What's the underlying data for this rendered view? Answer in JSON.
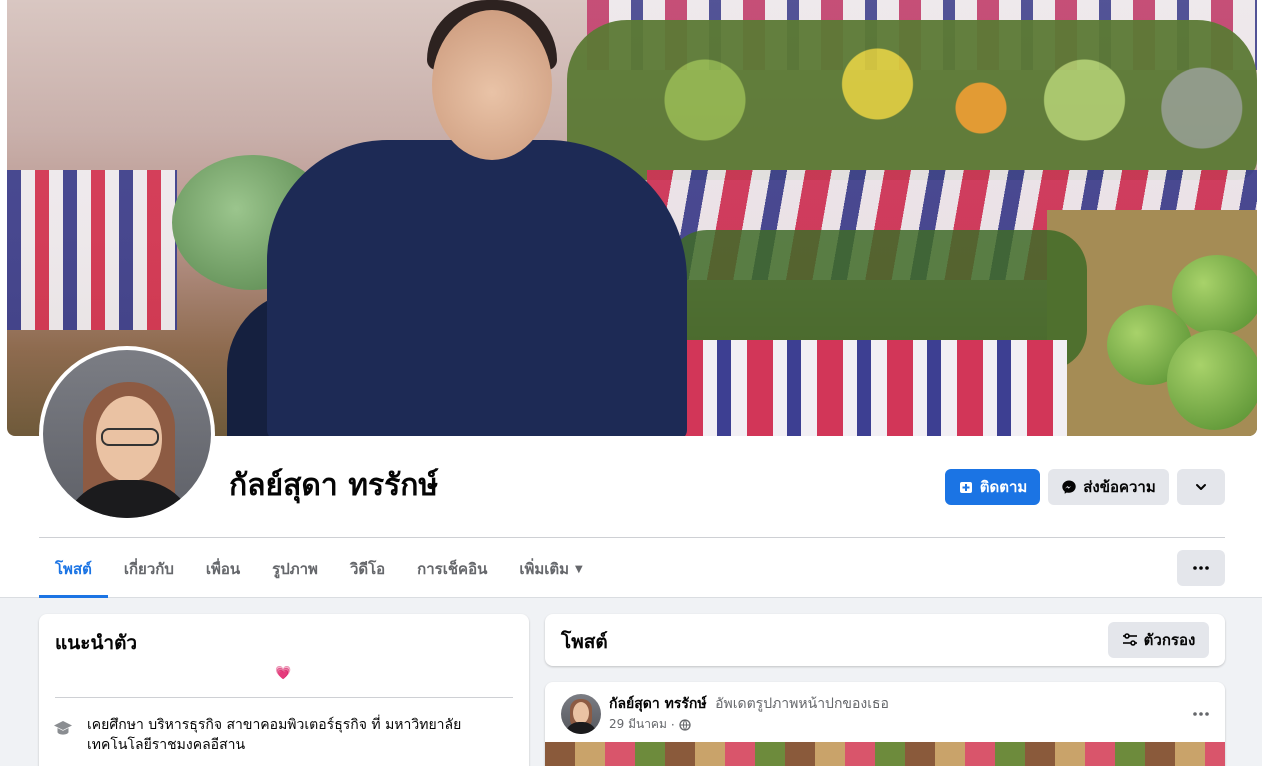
{
  "profile": {
    "name": "กัลย์สุดา ทรรักษ์",
    "follow_label": "ติดตาม",
    "message_label": "ส่งข้อความ"
  },
  "tabs": [
    {
      "label": "โพสต์",
      "active": true
    },
    {
      "label": "เกี่ยวกับ",
      "active": false
    },
    {
      "label": "เพื่อน",
      "active": false
    },
    {
      "label": "รูปภาพ",
      "active": false
    },
    {
      "label": "วิดีโอ",
      "active": false
    },
    {
      "label": "การเช็คอิน",
      "active": false
    },
    {
      "label": "เพิ่มเติม",
      "active": false
    }
  ],
  "intro": {
    "title": "แนะนำตัว",
    "bio_emoji": "💗",
    "education": "เคยศึกษา บริหารธุรกิจ สาขาคอมพิวเตอร์ธุรกิจ ที่ มหาวิทยาลัยเทคโนโลยีราชมงคลอีสาน"
  },
  "posts": {
    "title": "โพสต์",
    "filter_label": "ตัวกรอง",
    "first_post": {
      "author": "กัลย์สุดา ทรรักษ์",
      "action": "อัพเดตรูปภาพหน้าปกของเธอ",
      "date": "29 มีนาคม",
      "separator": "·"
    }
  },
  "colors": {
    "primary": "#1b74e4",
    "secondary_button": "#e4e6eb",
    "page_bg": "#f0f2f5"
  },
  "icons": {
    "follow": "follow-icon",
    "messenger": "messenger-icon",
    "chevron": "chevron-down-icon",
    "more": "more-icon",
    "filter": "filter-icon",
    "education": "graduation-cap-icon",
    "globe": "globe-icon"
  }
}
